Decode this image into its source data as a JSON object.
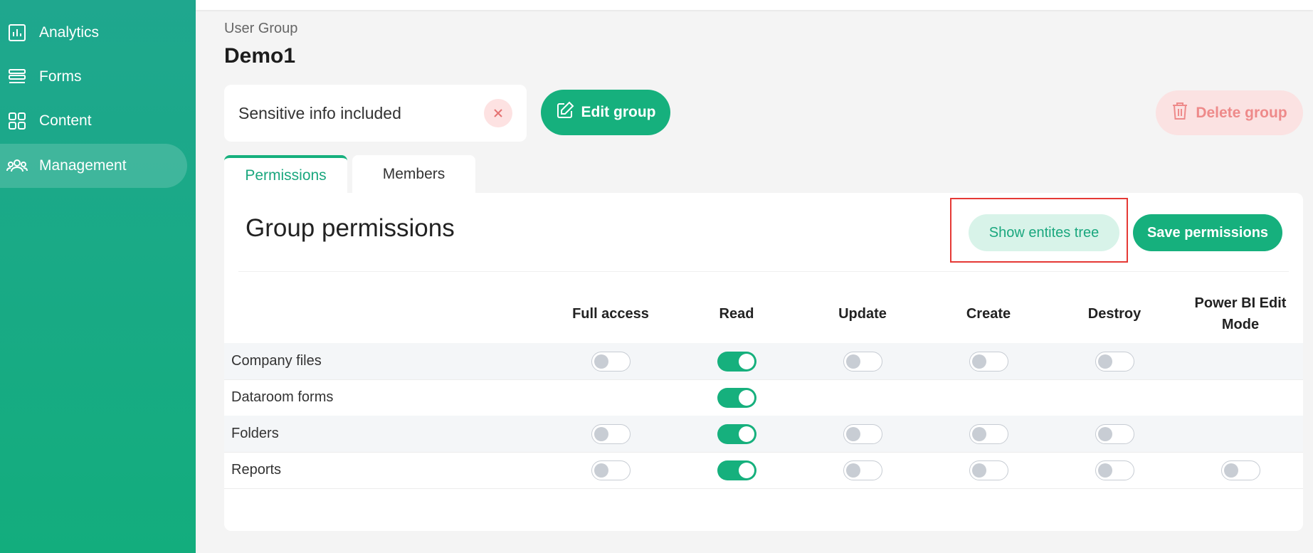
{
  "sidebar": {
    "items": [
      {
        "label": "Analytics",
        "icon": "chart-icon"
      },
      {
        "label": "Forms",
        "icon": "list-icon"
      },
      {
        "label": "Content",
        "icon": "grid-icon"
      },
      {
        "label": "Management",
        "icon": "users-icon",
        "active": true
      }
    ]
  },
  "header": {
    "breadcrumb": "User Group",
    "title": "Demo1"
  },
  "tag": {
    "label": "Sensitive info included"
  },
  "actions": {
    "edit_label": "Edit group",
    "delete_label": "Delete group"
  },
  "tabs": [
    {
      "label": "Permissions",
      "active": true
    },
    {
      "label": "Members"
    }
  ],
  "permissions": {
    "title": "Group permissions",
    "show_tree_label": "Show entites tree",
    "save_label": "Save permissions",
    "columns": [
      "Full access",
      "Read",
      "Update",
      "Create",
      "Destroy",
      "Power BI Edit Mode"
    ],
    "rows": [
      {
        "label": "Company files",
        "toggles": [
          false,
          true,
          false,
          false,
          false,
          null
        ]
      },
      {
        "label": "Dataroom forms",
        "toggles": [
          null,
          true,
          null,
          null,
          null,
          null
        ]
      },
      {
        "label": "Folders",
        "toggles": [
          false,
          true,
          false,
          false,
          false,
          null
        ]
      },
      {
        "label": "Reports",
        "toggles": [
          false,
          true,
          false,
          false,
          false,
          false
        ]
      }
    ]
  },
  "colors": {
    "accent": "#16b07d",
    "sidebar": "#1fa78e",
    "danger_bg": "#fbe2e2",
    "danger_text": "#ee8a8a",
    "highlight": "#e53935"
  }
}
